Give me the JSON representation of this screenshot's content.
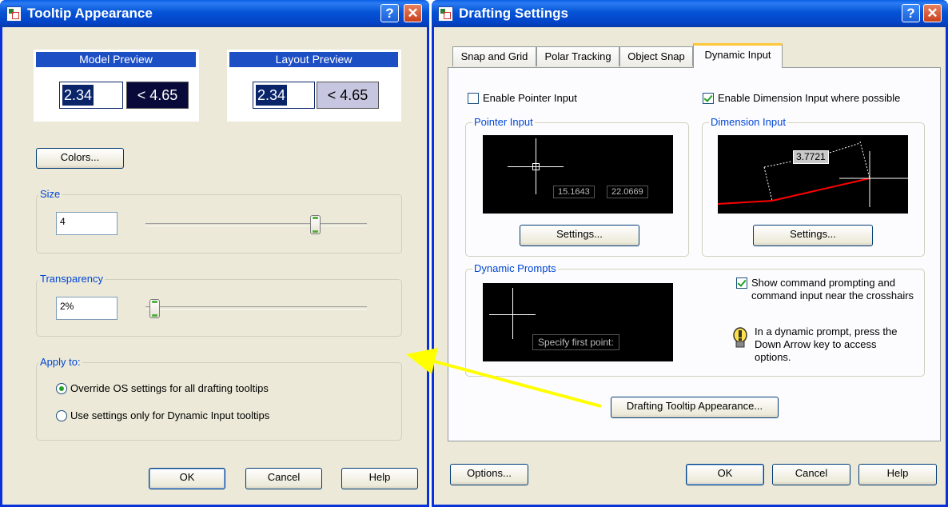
{
  "tooltip_window": {
    "title": "Tooltip Appearance",
    "help_glyph": "?",
    "close_glyph": "✕",
    "model_preview": {
      "header": "Model Preview",
      "value1": "2.34",
      "value2": "< 4.65"
    },
    "layout_preview": {
      "header": "Layout Preview",
      "value1": "2.34",
      "value2": "< 4.65"
    },
    "colors_button": "Colors...",
    "size": {
      "legend": "Size",
      "value": "4",
      "slider_level": 0.76
    },
    "transparency": {
      "legend": "Transparency",
      "value": "2%",
      "slider_level": 0.02
    },
    "apply_to": {
      "legend": "Apply to:",
      "options": [
        {
          "label": "Override OS settings for all drafting tooltips",
          "selected": true
        },
        {
          "label": "Use settings only for Dynamic Input tooltips",
          "selected": false
        }
      ]
    },
    "ok": "OK",
    "cancel": "Cancel",
    "help": "Help"
  },
  "drafting_window": {
    "title": "Drafting Settings",
    "help_glyph": "?",
    "close_glyph": "✕",
    "tabs": [
      {
        "label": "Snap and Grid",
        "active": false
      },
      {
        "label": "Polar Tracking",
        "active": false
      },
      {
        "label": "Object Snap",
        "active": false
      },
      {
        "label": "Dynamic Input",
        "active": true
      }
    ],
    "enable_pointer_input": {
      "label": "Enable Pointer Input",
      "checked": false
    },
    "enable_dimension_input": {
      "label": "Enable Dimension Input where possible",
      "checked": true
    },
    "pointer_input": {
      "legend": "Pointer Input",
      "coord_x": "15.1643",
      "coord_y": "22.0669",
      "settings": "Settings..."
    },
    "dimension_input": {
      "legend": "Dimension Input",
      "dim_value": "3.7721",
      "settings": "Settings..."
    },
    "dynamic_prompts": {
      "legend": "Dynamic Prompts",
      "prompt_text": "Specify first point:",
      "show_prompting": {
        "label_line1": "Show command prompting and",
        "label_line2": "command input near the crosshairs",
        "checked": true
      },
      "info_line1": "In a dynamic prompt, press the",
      "info_line2": "Down Arrow key to access",
      "info_line3": "options."
    },
    "tooltip_appearance_button": "Drafting Tooltip Appearance...",
    "options": "Options...",
    "ok": "OK",
    "cancel": "Cancel",
    "help": "Help"
  },
  "colors": {
    "titlebar": "#0553d6",
    "dialog_bg": "#ece9d8",
    "arrow": "#ffff00",
    "preview_box": "#0a246a",
    "dim_line": "#ff0000"
  }
}
